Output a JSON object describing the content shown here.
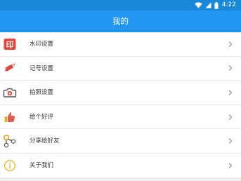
{
  "status_bar": {
    "time": "4:22",
    "icons": [
      "wifi-icon",
      "signal-icon",
      "battery-icon"
    ],
    "color": "#1a88d8"
  },
  "app_bar": {
    "title": "我的",
    "color": "#2196f3"
  },
  "menu": {
    "items": [
      {
        "label": "水印设置",
        "icon": "watermark-icon"
      },
      {
        "label": "记号设置",
        "icon": "marker-icon"
      },
      {
        "label": "拍照设置",
        "icon": "camera-icon"
      },
      {
        "label": "给个好评",
        "icon": "thumbs-up-icon"
      },
      {
        "label": "分享给好友",
        "icon": "share-icon"
      },
      {
        "label": "关于我们",
        "icon": "info-icon"
      }
    ]
  },
  "watermark_icon_text": "印"
}
